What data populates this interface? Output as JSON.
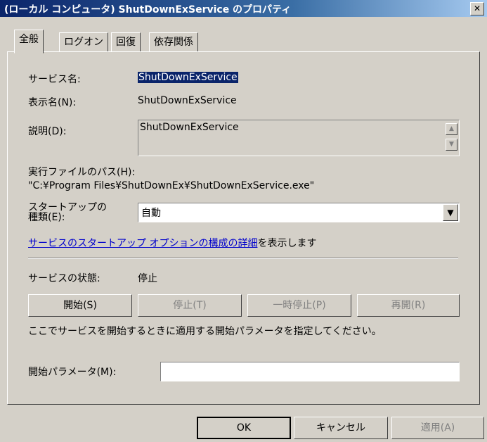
{
  "window": {
    "title": "(ローカル コンピュータ) ShutDownExService のプロパティ",
    "close_label": "✕"
  },
  "tabs": [
    {
      "label": "全般",
      "active": true
    },
    {
      "label": "ログオン",
      "active": false
    },
    {
      "label": "回復",
      "active": false
    },
    {
      "label": "依存関係",
      "active": false
    }
  ],
  "general": {
    "service_name_label": "サービス名:",
    "service_name_value": "ShutDownExService",
    "display_name_label": "表示名(N):",
    "display_name_value": "ShutDownExService",
    "description_label": "説明(D):",
    "description_value": "ShutDownExService",
    "exe_path_label": "実行ファイルのパス(H):",
    "exe_path_value": "\"C:¥Program Files¥ShutDownEx¥ShutDownExService.exe\"",
    "startup_type_label_line1": "スタートアップの",
    "startup_type_label_line2": "種類(E):",
    "startup_type_value": "自動",
    "details_link_text": "サービスのスタートアップ オプションの構成の詳細",
    "details_link_suffix": "を表示します",
    "status_label": "サービスの状態:",
    "status_value": "停止",
    "start_button": "開始(S)",
    "stop_button": "停止(T)",
    "pause_button": "一時停止(P)",
    "resume_button": "再開(R)",
    "param_hint": "ここでサービスを開始するときに適用する開始パラメータを指定してください。",
    "param_label": "開始パラメータ(M):",
    "param_value": ""
  },
  "footer": {
    "ok": "OK",
    "cancel": "キャンセル",
    "apply": "適用(A)"
  }
}
